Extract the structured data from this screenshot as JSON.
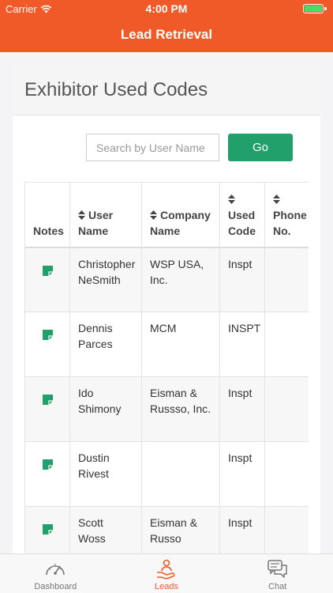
{
  "status_bar": {
    "carrier": "Carrier",
    "time": "4:00 PM",
    "battery_color": "#4cd964"
  },
  "nav": {
    "title": "Lead Retrieval",
    "color": "#f05a28"
  },
  "card": {
    "title": "Exhibitor Used Codes"
  },
  "search": {
    "placeholder": "Search by User Name",
    "value": "",
    "go_label": "Go",
    "go_color": "#22a06b"
  },
  "table": {
    "headers": [
      {
        "label": "Notes",
        "sortable": false
      },
      {
        "label": "User Name",
        "sortable": true
      },
      {
        "label": "Company Name",
        "sortable": true
      },
      {
        "label": "Used Code",
        "sortable": true
      },
      {
        "label": "Phone No.",
        "sortable": true
      }
    ],
    "rows": [
      {
        "user_name": "Christopher NeSmith",
        "company": "WSP USA, Inc.",
        "code": "Inspt",
        "phone": ""
      },
      {
        "user_name": "Dennis Parces",
        "company": "MCM",
        "code": "INSPT",
        "phone": ""
      },
      {
        "user_name": "Ido Shimony",
        "company": "Eisman & Russso, Inc.",
        "code": "Inspt",
        "phone": ""
      },
      {
        "user_name": "Dustin Rivest",
        "company": "",
        "code": "Inspt",
        "phone": ""
      },
      {
        "user_name": "Scott Woss",
        "company": "Eisman & Russo",
        "code": "Inspt",
        "phone": ""
      }
    ],
    "note_icon": "note-icon",
    "note_icon_color": "#22a06b"
  },
  "tabbar": {
    "items": [
      {
        "label": "Dashboard",
        "icon": "speedometer-icon",
        "active": false
      },
      {
        "label": "Leads",
        "icon": "leads-hand-icon",
        "active": true
      },
      {
        "label": "Chat",
        "icon": "chat-bubbles-icon",
        "active": false
      }
    ],
    "active_color": "#f05a28"
  }
}
